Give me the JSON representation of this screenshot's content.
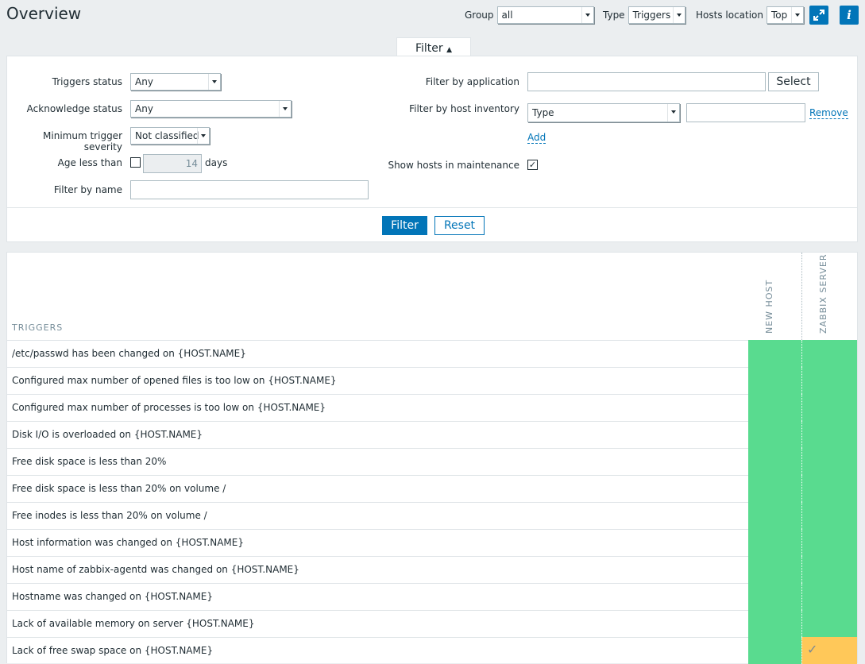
{
  "header": {
    "title": "Overview",
    "group_label": "Group",
    "group_value": "all",
    "type_label": "Type",
    "type_value": "Triggers",
    "hosts_location_label": "Hosts location",
    "hosts_location_value": "Top",
    "fullscreen_icon": "fullscreen-icon",
    "info_icon": "info-icon",
    "info_glyph": "i"
  },
  "filter": {
    "tab_label": "Filter",
    "tab_arrow": "▲",
    "triggers_status_label": "Triggers status",
    "triggers_status_value": "Any",
    "ack_status_label": "Acknowledge status",
    "ack_status_value": "Any",
    "min_severity_label": "Minimum trigger severity",
    "min_severity_value": "Not classified",
    "age_less_than_label": "Age less than",
    "age_value": "14",
    "age_unit": "days",
    "filter_by_name_label": "Filter by name",
    "filter_by_name_value": "",
    "filter_by_application_label": "Filter by application",
    "filter_by_application_value": "",
    "select_button": "Select",
    "filter_by_inventory_label": "Filter by host inventory",
    "inventory_field_value": "Type",
    "inventory_value": "",
    "remove_link": "Remove",
    "add_link": "Add",
    "show_maintenance_label": "Show hosts in maintenance",
    "show_maintenance_checked": true,
    "filter_button": "Filter",
    "reset_button": "Reset"
  },
  "table": {
    "triggers_header": "TRIGGERS",
    "hosts": [
      "NEW HOST",
      "ZABBIX SERVER"
    ],
    "rows": [
      {
        "name": "/etc/passwd has been changed on {HOST.NAME}",
        "states": [
          "ok",
          "ok"
        ]
      },
      {
        "name": "Configured max number of opened files is too low on {HOST.NAME}",
        "states": [
          "ok",
          "ok"
        ]
      },
      {
        "name": "Configured max number of processes is too low on {HOST.NAME}",
        "states": [
          "ok",
          "ok"
        ]
      },
      {
        "name": "Disk I/O is overloaded on {HOST.NAME}",
        "states": [
          "ok",
          "ok"
        ]
      },
      {
        "name": "Free disk space is less than 20%",
        "states": [
          "ok",
          "ok"
        ]
      },
      {
        "name": "Free disk space is less than 20% on volume /",
        "states": [
          "ok",
          "ok"
        ]
      },
      {
        "name": "Free inodes is less than 20% on volume /",
        "states": [
          "ok",
          "ok"
        ]
      },
      {
        "name": "Host information was changed on {HOST.NAME}",
        "states": [
          "ok",
          "ok"
        ]
      },
      {
        "name": "Host name of zabbix-agentd was changed on {HOST.NAME}",
        "states": [
          "ok",
          "ok"
        ]
      },
      {
        "name": "Hostname was changed on {HOST.NAME}",
        "states": [
          "ok",
          "ok"
        ]
      },
      {
        "name": "Lack of available memory on server {HOST.NAME}",
        "states": [
          "ok",
          "ok"
        ]
      },
      {
        "name": "Lack of free swap space on {HOST.NAME}",
        "states": [
          "ok",
          "warn"
        ]
      }
    ],
    "colors": {
      "ok": "#59db8f",
      "warn": "#ffc859"
    }
  }
}
